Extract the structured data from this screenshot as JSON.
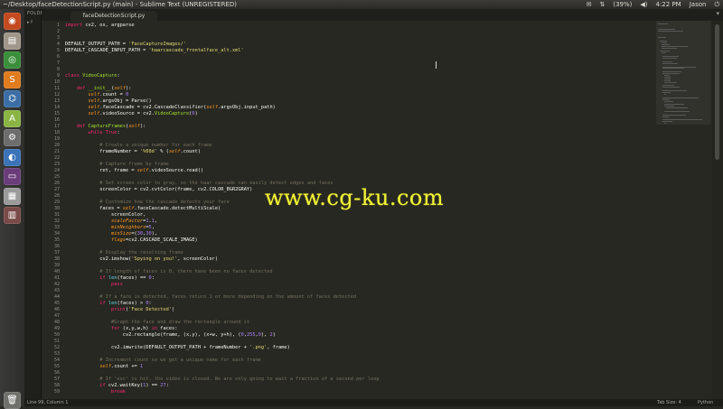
{
  "window": {
    "title": "~/Desktop/faceDetectionScript.py (main) - Sublime Text (UNREGISTERED)"
  },
  "tray": {
    "battery": "(39%)",
    "volume": "◀)",
    "time": "4:22 PM",
    "user": "Jason"
  },
  "sidebar": {
    "folders_label": "FOLDERS",
    "folder": "▸ f"
  },
  "tab": {
    "label": "faceDetectionScript.py",
    "close": "×"
  },
  "status": {
    "position": "Line 99, Column 1",
    "tab_size": "Tab Size: 4",
    "syntax": "Python"
  },
  "watermark": "www.cg-ku.com",
  "line_numbers": [
    "1",
    "2",
    "3",
    "4",
    "5",
    "6",
    "7",
    "8",
    "9",
    "10",
    "11",
    "12",
    "13",
    "14",
    "15",
    "16",
    "17",
    "18",
    "19",
    "20",
    "21",
    "22",
    "23",
    "24",
    "25",
    "26",
    "27",
    "28",
    "29",
    "30",
    "31",
    "32",
    "33",
    "34",
    "35",
    "36",
    "37",
    "38",
    "39",
    "40",
    "41",
    "42",
    "43",
    "44",
    "45",
    "46",
    "47",
    "48",
    "49",
    "50",
    "51",
    "52",
    "53",
    "54",
    "55",
    "56",
    "57",
    "58",
    "59"
  ],
  "code_lines": [
    "import cv2, os, argparse",
    "",
    "",
    "DEFAULT_OUTPUT_PATH = 'FaceCaptureImages/'",
    "DEFAULT_CASCADE_INPUT_PATH = 'haarcascade_frontalface_alt.xml'",
    "",
    "",
    "",
    "class VideoCapture:",
    "",
    "    def __init__(self):",
    "        self.count = 0",
    "        self.argsObj = Parse()",
    "        self.faceCascade = cv2.CascadeClassifier(self.argsObj.input_path)",
    "        self.videoSource = cv2.VideoCapture(0)",
    "",
    "    def CaptureFrames(self):",
    "        while True:",
    "",
    "            # Create a unique number for each frame",
    "            frameNumber = '%08d' % (self.count)",
    "",
    "            # Capture frame by frame",
    "            ret, frame = self.videoSource.read()",
    "",
    "            # Set screen color to gray, so the haar cascade can easily detect edges and faces",
    "            screenColor = cv2.cvtColor(frame, cv2.COLOR_BGR2GRAY)",
    "",
    "            # Customize how the cascade detects your face",
    "            faces = self.faceCascade.detectMultiScale(",
    "                screenColor,",
    "                scaleFactor=1.1,",
    "                minNeighbors=5,",
    "                minSize=(30,30),",
    "                flags=cv2.CASCADE_SCALE_IMAGE)",
    "",
    "            # Display the resulting frame",
    "            cv2.imshow('Spying on you!', screenColor)",
    "",
    "            # If length of faces is 0, there have been no faces detected",
    "            if len(faces) == 0:",
    "                pass",
    "",
    "            # If a face is detected, faces return 1 or more depending on the amount of faces detected",
    "            if len(faces) > 0:",
    "                print('Face Detected')",
    "",
    "                #Graph the face and draw the rectangle around it",
    "                for (x,y,w,h) in faces:",
    "                    cv2.rectangle(frame, (x,y), (x+w, y+h), (0,255,0), 2)",
    "",
    "                cv2.imwrite(DEFAULT_OUTPUT_PATH + frameNumber + '.png', frame)",
    "",
    "            # Increment count so we get a unique name for each frame",
    "            self.count += 1",
    "",
    "            # If 'esc' is hit, the video is closed. We are only going to wait a fraction of a second per loop",
    "            if cv2.waitKey(1) == 27:",
    "                break"
  ],
  "launcher_icons": [
    {
      "name": "dash-icon",
      "color": "#c4491f",
      "glyph": "◉"
    },
    {
      "name": "files-icon",
      "color": "#a0978a",
      "glyph": "▤"
    },
    {
      "name": "chrome-icon",
      "color": "#3a8f3a",
      "glyph": "◎"
    },
    {
      "name": "sublime-icon",
      "color": "#e07b1e",
      "glyph": "S"
    },
    {
      "name": "python-icon",
      "color": "#3a6ea5",
      "glyph": "⌬"
    },
    {
      "name": "android-icon",
      "color": "#8ab545",
      "glyph": "A"
    },
    {
      "name": "settings-icon",
      "color": "#6d6d6d",
      "glyph": "⚙"
    },
    {
      "name": "firefox-icon",
      "color": "#3b73b9",
      "glyph": "◐"
    },
    {
      "name": "terminal-icon",
      "color": "#6b3c7a",
      "glyph": "▭"
    },
    {
      "name": "software-icon",
      "color": "#9a9a9a",
      "glyph": "▦"
    },
    {
      "name": "workspaces-icon",
      "color": "#7a4a48",
      "glyph": "▥"
    }
  ]
}
